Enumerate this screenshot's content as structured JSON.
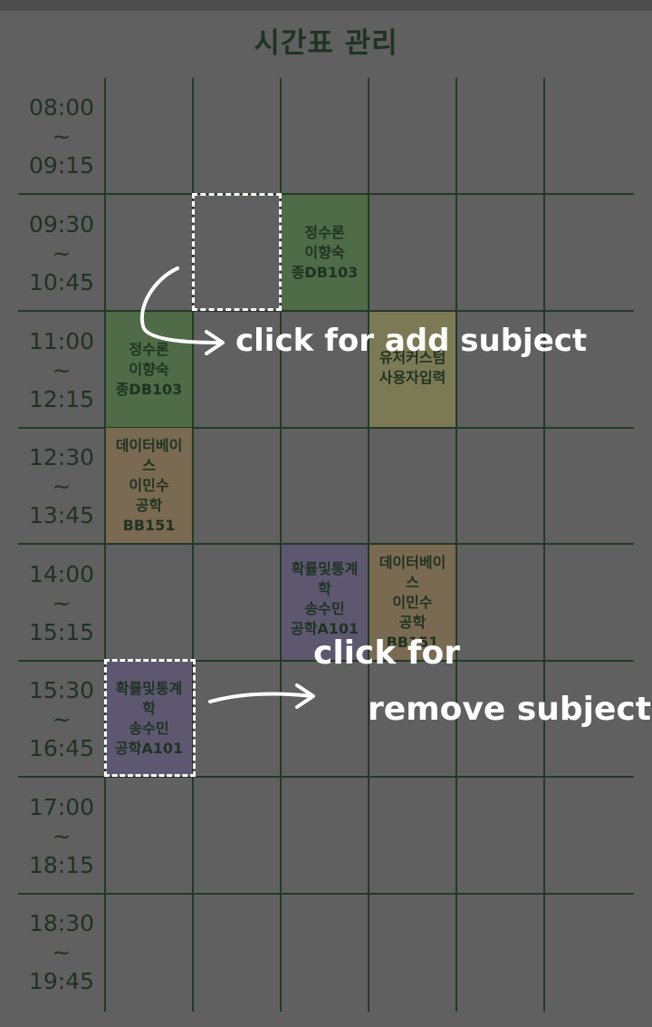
{
  "title": "시간표 관리",
  "timeslots": [
    {
      "start": "08:00",
      "sep": "~",
      "end": "09:15"
    },
    {
      "start": "09:30",
      "sep": "~",
      "end": "10:45"
    },
    {
      "start": "11:00",
      "sep": "~",
      "end": "12:15"
    },
    {
      "start": "12:30",
      "sep": "~",
      "end": "13:45"
    },
    {
      "start": "14:00",
      "sep": "~",
      "end": "15:15"
    },
    {
      "start": "15:30",
      "sep": "~",
      "end": "16:45"
    },
    {
      "start": "17:00",
      "sep": "~",
      "end": "18:15"
    },
    {
      "start": "18:30",
      "sep": "~",
      "end": "19:45"
    }
  ],
  "subjects": {
    "s1": {
      "lines": [
        "정수론",
        "이향숙",
        "종DB103"
      ]
    },
    "s2": {
      "lines": [
        "정수론",
        "이향숙",
        "종DB103"
      ]
    },
    "s3": {
      "lines": [
        "유저커스텀",
        "사용자입력"
      ]
    },
    "s4": {
      "lines": [
        "데이터베이",
        "스",
        "이민수",
        "공학",
        "BB151"
      ]
    },
    "s5": {
      "lines": [
        "확률및통계",
        "학",
        "송수민",
        "공학A101"
      ]
    },
    "s6": {
      "lines": [
        "데이터베이",
        "스",
        "이민수",
        "공학",
        "BB151"
      ]
    },
    "s7": {
      "lines": [
        "확률및통계",
        "학",
        "송수민",
        "공학A101"
      ]
    }
  },
  "annotations": {
    "add": "click for add subject",
    "remove_1": "click for",
    "remove_2": "remove subject"
  },
  "colors": {
    "background": "#606060",
    "grid": "#223a27",
    "green": "#4f6b47",
    "brown": "#7a6a52",
    "purple": "#5d5870",
    "olive": "#7c7a55",
    "annotation": "#ffffff"
  }
}
